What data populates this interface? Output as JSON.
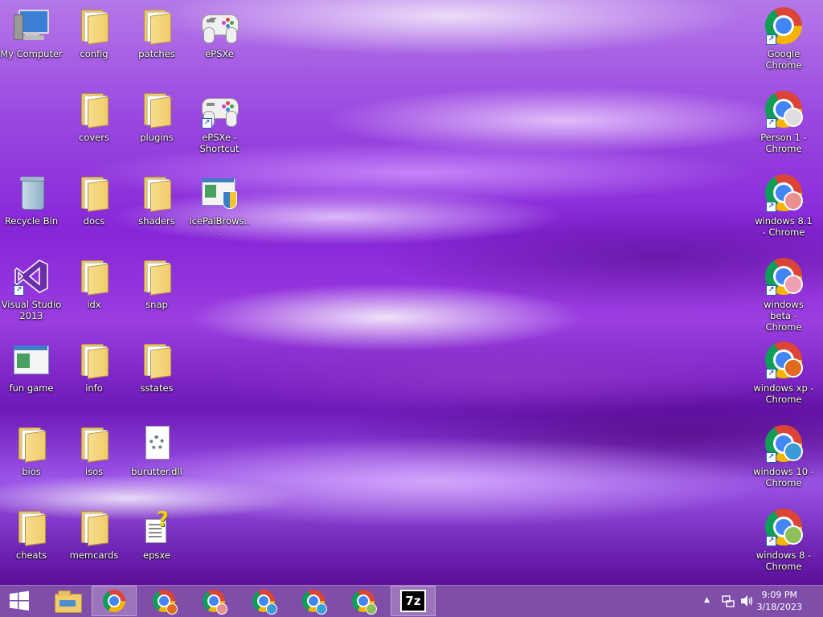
{
  "desktop": {
    "icons": [
      {
        "label": "My Computer"
      },
      {
        "label": "config"
      },
      {
        "label": "patches"
      },
      {
        "label": "ePSXe"
      },
      {
        "label": "covers"
      },
      {
        "label": "plugins"
      },
      {
        "label": "ePSXe - Shortcut"
      },
      {
        "label": "Recycle Bin"
      },
      {
        "label": "docs"
      },
      {
        "label": "shaders"
      },
      {
        "label": "IcePalBrows..."
      },
      {
        "label": "Visual Studio 2013"
      },
      {
        "label": "idx"
      },
      {
        "label": "snap"
      },
      {
        "label": "fun game"
      },
      {
        "label": "info"
      },
      {
        "label": "sstates"
      },
      {
        "label": "bios"
      },
      {
        "label": "isos"
      },
      {
        "label": "burutter.dll"
      },
      {
        "label": "cheats"
      },
      {
        "label": "memcards"
      },
      {
        "label": "epsxe"
      },
      {
        "label": "Google Chrome"
      },
      {
        "label": "Person 1 - Chrome"
      },
      {
        "label": "windows 8.1 - Chrome"
      },
      {
        "label": "windows beta - Chrome"
      },
      {
        "label": "windows xp - Chrome"
      },
      {
        "label": "windows 10 - Chrome"
      },
      {
        "label": "windows 8 - Chrome"
      }
    ]
  },
  "taskbar": {
    "seven_zip_label": "7z",
    "time": "9:09 PM",
    "date": "3/18/2023",
    "tray_arrow": "▲",
    "badge_colors": [
      "#e06a1e",
      "#e89090",
      "#3a9bd8",
      "#3aa0d8",
      "#8fbf5a"
    ]
  },
  "colors": {
    "taskbar": "#7f4ea8",
    "folder": "#f0cc6a",
    "start_logo": "#ffffff"
  }
}
